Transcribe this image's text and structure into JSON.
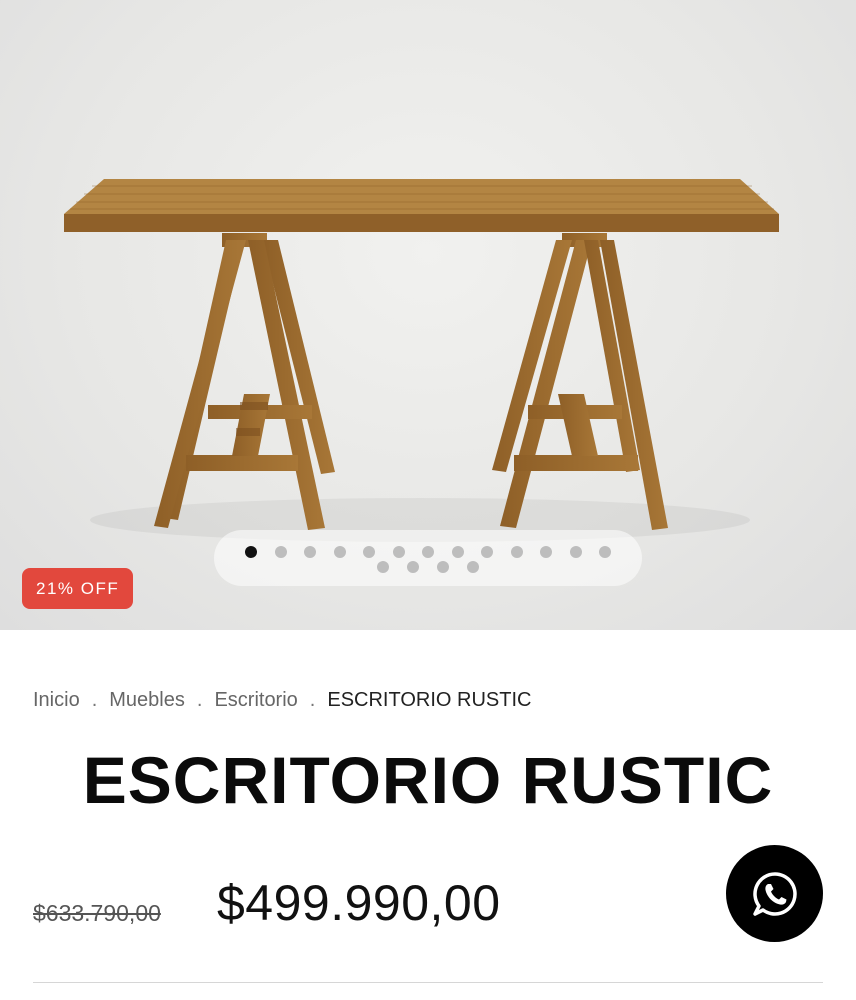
{
  "product": {
    "badge": "21% OFF",
    "title": "ESCRITORIO RUSTIC",
    "old_price": "$633.790,00",
    "price": "$499.990,00",
    "image_alt": "Escritorio de madera rústica sobre caballetes"
  },
  "gallery": {
    "total_images": 17,
    "current_index": 1
  },
  "breadcrumb": {
    "items": [
      "Inicio",
      "Muebles",
      "Escritorio"
    ],
    "current": "ESCRITORIO RUSTIC",
    "separator": "."
  },
  "whatsapp": {
    "icon": "whatsapp-icon"
  },
  "colors": {
    "badge": "#e2483d",
    "wood": "#a9793a",
    "active_dot": "#111111",
    "inactive_dot": "#bdbdbd"
  }
}
